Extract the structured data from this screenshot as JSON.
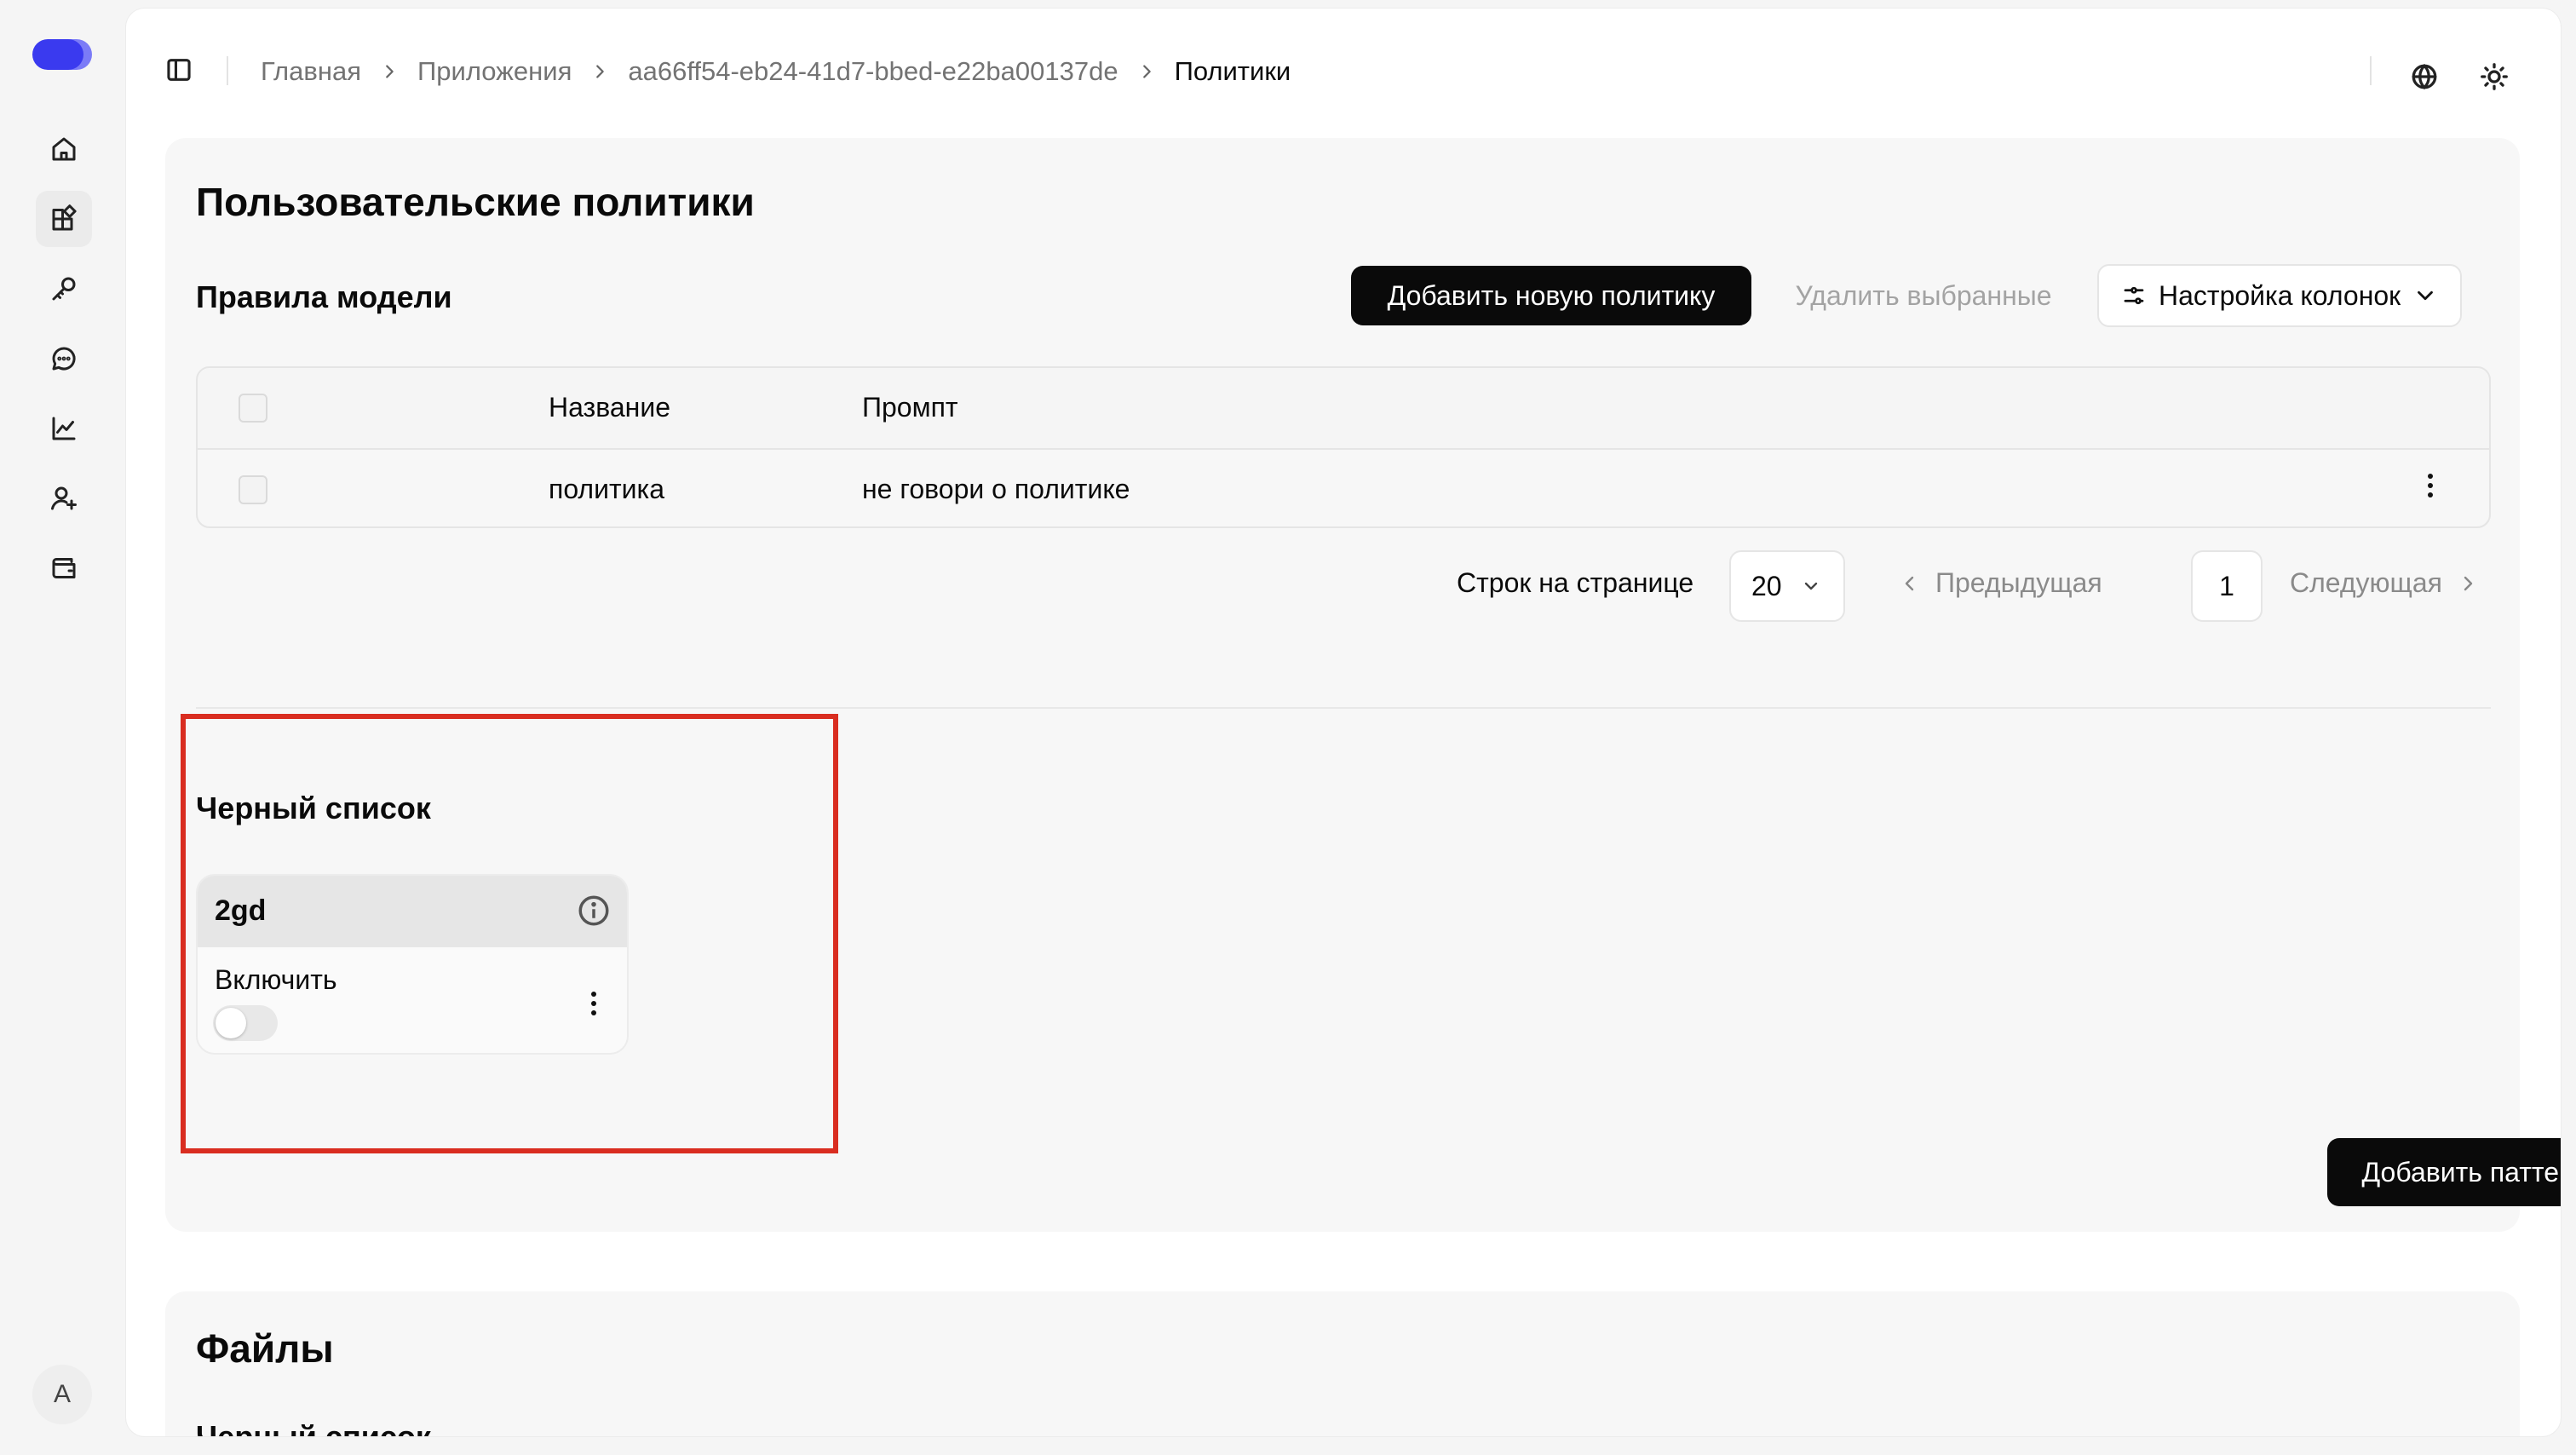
{
  "colors": {
    "accent": "#0a0a0a",
    "highlight": "#d92d20",
    "logo": "#3b3bf0"
  },
  "sidebar": {
    "items": [
      {
        "icon": "home-icon"
      },
      {
        "icon": "apps-icon",
        "active": true
      },
      {
        "icon": "key-icon"
      },
      {
        "icon": "chat-icon"
      },
      {
        "icon": "chart-icon"
      },
      {
        "icon": "user-plus-icon"
      },
      {
        "icon": "wallet-icon"
      }
    ],
    "avatar_letter": "A"
  },
  "breadcrumb": {
    "home": "Главная",
    "apps": "Приложения",
    "app_id": "aa66ff54-eb24-41d7-bbed-e22ba00137de",
    "current": "Политики"
  },
  "policies": {
    "title": "Пользовательские политики",
    "rules_title": "Правила модели",
    "add_button": "Добавить новую политику",
    "delete_button": "Удалить выбранные",
    "columns_button": "Настройка колонок",
    "table": {
      "headers": [
        "Название",
        "Промпт"
      ],
      "rows": [
        {
          "name": "политика",
          "prompt": "не говори о политике"
        }
      ]
    },
    "pagination": {
      "rows_label": "Строк на странице",
      "rows_value": "20",
      "prev": "Предыдущая",
      "page": "1",
      "next": "Следующая"
    },
    "blacklist": {
      "title": "Черный список",
      "card_name": "2gd",
      "enable_label": "Включить",
      "enabled": false
    },
    "add_pattern_button": "Добавить паттерн"
  },
  "files": {
    "title": "Файлы",
    "subtitle": "Черный список"
  }
}
